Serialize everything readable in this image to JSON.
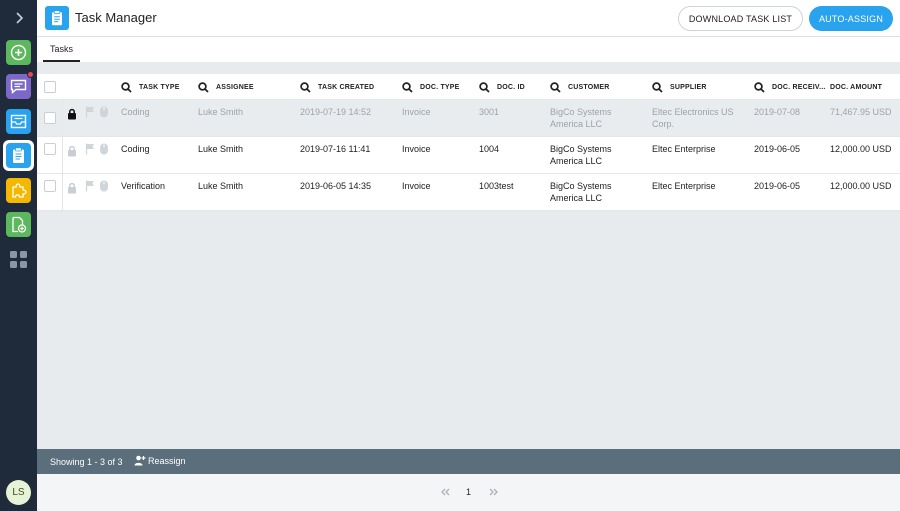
{
  "app": {
    "title": "Task Manager"
  },
  "header": {
    "download_label": "DOWNLOAD TASK LIST",
    "autoassign_label": "AUTO-ASSIGN"
  },
  "tabs": [
    {
      "label": "Tasks",
      "active": true
    }
  ],
  "sidebar": {
    "items": [
      {
        "name": "add",
        "color": "#5cb85c"
      },
      {
        "name": "messages",
        "color": "#7b68c9",
        "has_notification": true
      },
      {
        "name": "inbox",
        "color": "#2aa3ef"
      },
      {
        "name": "task-manager",
        "color": "#2aa3ef",
        "active": true
      },
      {
        "name": "plugins",
        "color": "#f5b800"
      },
      {
        "name": "new-document",
        "color": "#5cb85c"
      },
      {
        "name": "apps",
        "color": "#8a95a5"
      }
    ],
    "user_initials": "LS"
  },
  "table": {
    "columns": [
      "TASK TYPE",
      "ASSIGNEE",
      "TASK CREATED",
      "DOC. TYPE",
      "DOC. ID",
      "CUSTOMER",
      "SUPPLIER",
      "DOC. RECEIV...",
      "DOC. AMOUNT"
    ],
    "rows": [
      {
        "locked": true,
        "selected": true,
        "task_type": "Coding",
        "assignee": "Luke Smith",
        "task_created": "2019-07-19 14:52",
        "doc_type": "Invoice",
        "doc_id": "3001",
        "customer": "BigCo Systems America LLC",
        "supplier": "Eltec Electronics US Corp.",
        "doc_received": "2019-07-08",
        "doc_amount": "71,467.95 USD"
      },
      {
        "locked": false,
        "selected": false,
        "task_type": "Coding",
        "assignee": "Luke Smith",
        "task_created": "2019-07-16 11:41",
        "doc_type": "Invoice",
        "doc_id": "1004",
        "customer": "BigCo Systems America LLC",
        "supplier": "Eltec Enterprise",
        "doc_received": "2019-06-05",
        "doc_amount": "12,000.00 USD"
      },
      {
        "locked": false,
        "selected": false,
        "task_type": "Verification",
        "assignee": "Luke Smith",
        "task_created": "2019-06-05 14:35",
        "doc_type": "Invoice",
        "doc_id": "1003test",
        "customer": "BigCo Systems America LLC",
        "supplier": "Eltec Enterprise",
        "doc_received": "2019-06-05",
        "doc_amount": "12,000.00 USD"
      }
    ]
  },
  "footer": {
    "showing": "Showing 1 - 3 of 3",
    "reassign_label": "Reassign"
  },
  "pagination": {
    "current_page": "1"
  }
}
